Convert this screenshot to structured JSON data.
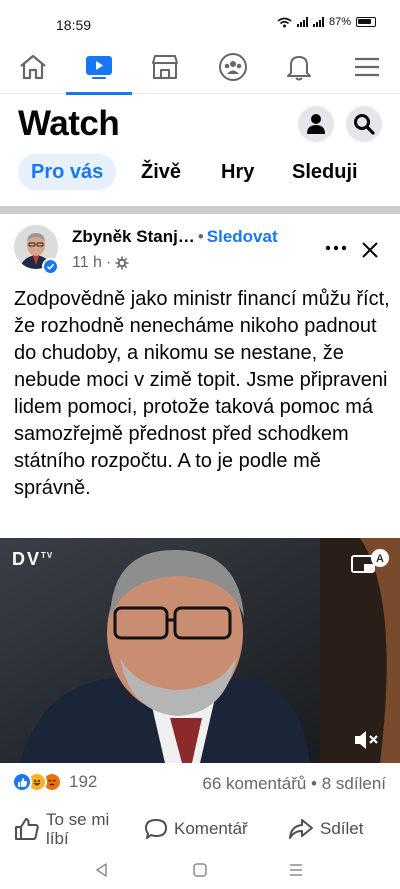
{
  "status_bar": {
    "time": "18:59",
    "battery": "87%"
  },
  "navbar": {
    "items": [
      {
        "icon": "home-icon"
      },
      {
        "icon": "watch-icon",
        "active": true
      },
      {
        "icon": "marketplace-icon"
      },
      {
        "icon": "groups-icon"
      },
      {
        "icon": "notifications-icon"
      },
      {
        "icon": "menu-icon"
      }
    ],
    "accent": "#1877f2"
  },
  "header": {
    "title": "Watch",
    "profile_icon": "profile-icon",
    "search_icon": "search-icon"
  },
  "chips": [
    {
      "label": "Pro vás",
      "active": true
    },
    {
      "label": "Živě"
    },
    {
      "label": "Hry"
    },
    {
      "label": "Sleduji"
    }
  ],
  "post": {
    "author": "Zbyněk Stanj…",
    "separator": "•",
    "follow_label": "Sledovat",
    "time": "11 h",
    "meta_sep": "·",
    "text": "Zodpovědně jako ministr financí můžu říct, že rozhodně nenecháme nikoho padnout do chudoby, a nikomu se nestane, že nebude moci v zimě topit. Jsme připraveni lidem pomoci, protože taková pomoc má samozřejmě přednost před schodkem státního rozpočtu. A to je podle mě správně.",
    "video": {
      "logo": "DV",
      "logo_sup": "TV"
    },
    "reactions": {
      "count": "192",
      "icons": [
        "like-icon",
        "haha-icon",
        "angry-icon"
      ]
    },
    "comments": "66 komentářů",
    "counts_sep": "•",
    "shares": "8 sdílení",
    "actions": {
      "like": "To se mi líbí",
      "comment": "Komentář",
      "share": "Sdílet"
    }
  },
  "system_nav": {
    "back": "back-icon",
    "home": "home-circle-icon",
    "recents": "recents-icon"
  }
}
